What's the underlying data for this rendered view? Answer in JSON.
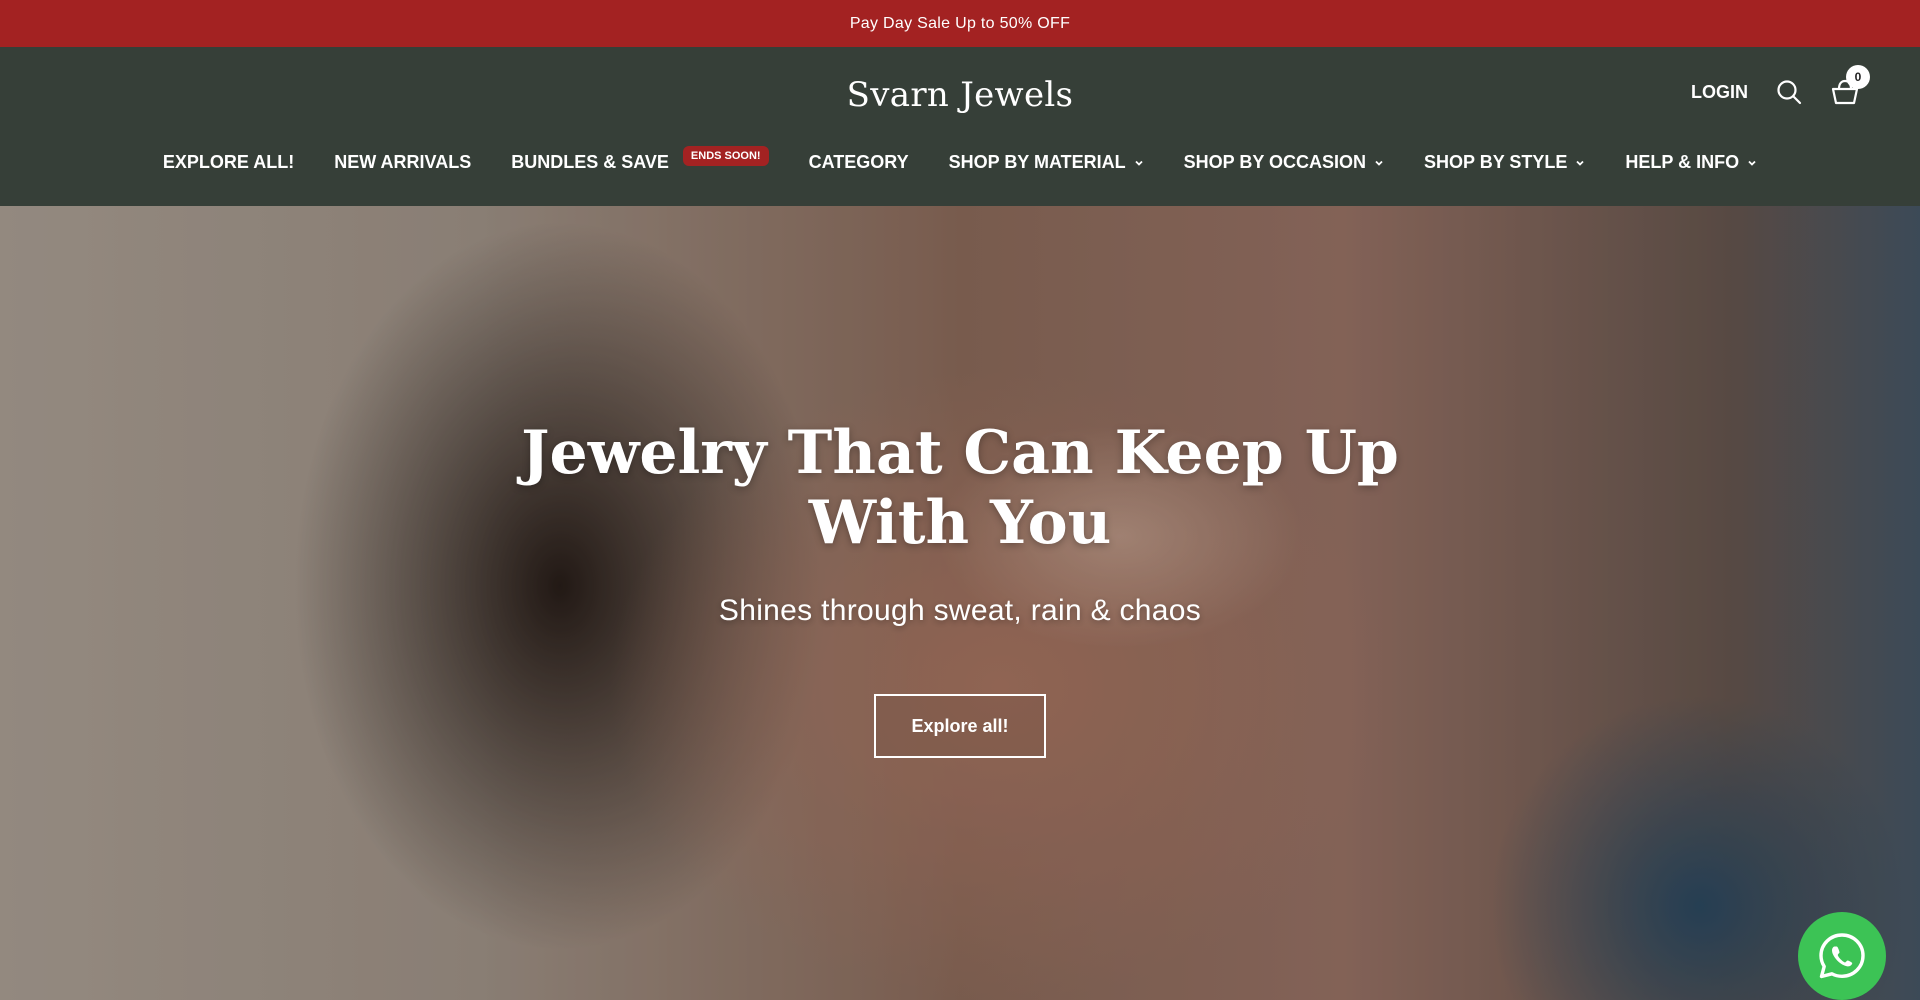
{
  "announcement": {
    "text": "Pay Day Sale Up to 50% OFF"
  },
  "header": {
    "logo": "Svarn Jewels",
    "login": "LOGIN",
    "cart_count": "0"
  },
  "nav": {
    "items": [
      {
        "label": "EXPLORE ALL!"
      },
      {
        "label": "NEW ARRIVALS"
      },
      {
        "label": "BUNDLES & SAVE",
        "badge": "ENDS SOON!"
      },
      {
        "label": "CATEGORY"
      },
      {
        "label": "SHOP BY MATERIAL"
      },
      {
        "label": "SHOP BY OCCASION"
      },
      {
        "label": "SHOP BY STYLE"
      },
      {
        "label": "HELP & INFO"
      }
    ]
  },
  "hero": {
    "title": "Jewelry That Can Keep Up With You",
    "subtitle": "Shines through sweat, rain & chaos",
    "button_label": "Explore all!"
  },
  "colors": {
    "announcement_bg": "#a32222",
    "header_bg": "#363f38",
    "badge_bg": "#a32222",
    "whatsapp": "#3cc355"
  },
  "icons": [
    "search-icon",
    "cart-icon",
    "chevron-down-icon",
    "whatsapp-icon"
  ]
}
